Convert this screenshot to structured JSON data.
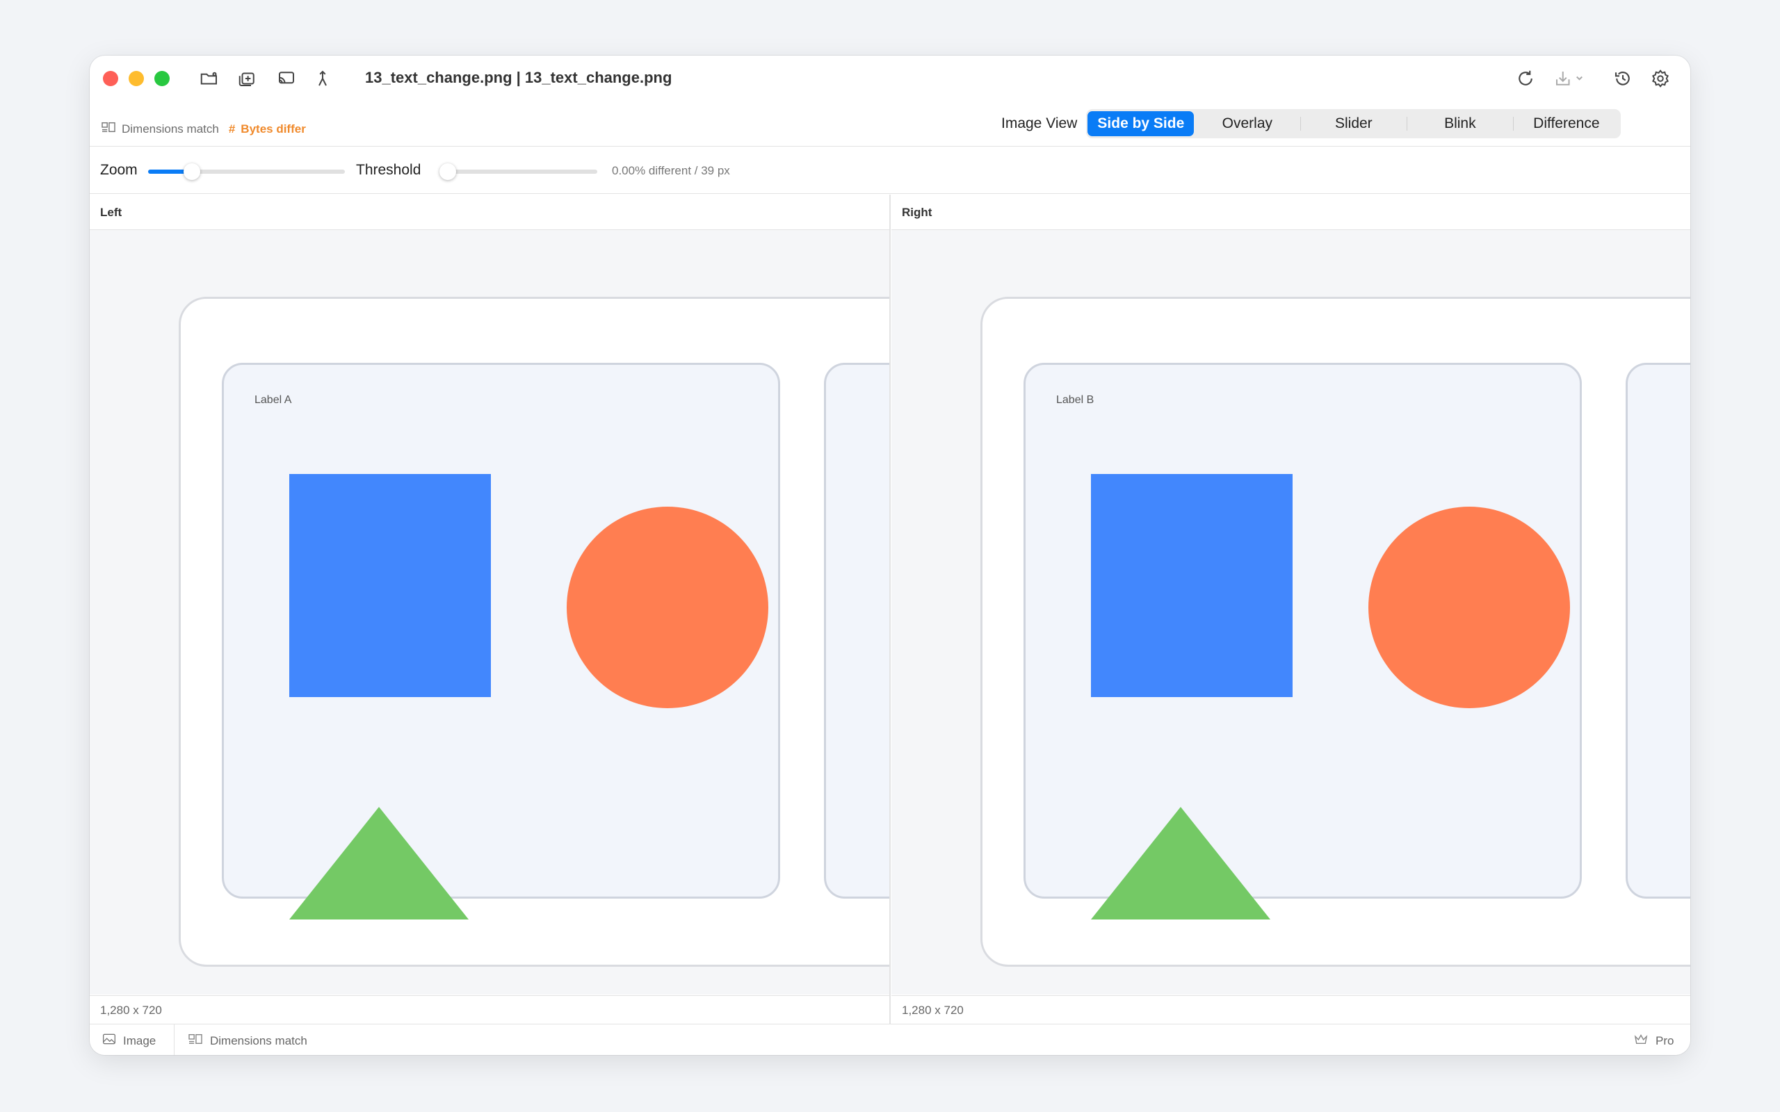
{
  "window": {
    "title": "13_text_change.png | 13_text_change.png"
  },
  "info": {
    "dimensions_match": "Dimensions match",
    "hash_symbol": "#",
    "bytes_differ": "Bytes differ"
  },
  "view_mode": {
    "label": "Image View",
    "options": [
      "Side by Side",
      "Overlay",
      "Slider",
      "Blink",
      "Difference"
    ],
    "selected": "Side by Side"
  },
  "controls": {
    "zoom_label": "Zoom",
    "zoom_level": 0.2,
    "threshold_label": "Threshold",
    "threshold_level": 0.0,
    "diff_text": "0.00% different / 39 px"
  },
  "panes": {
    "left": {
      "title": "Left",
      "image_label": "Label A",
      "dimensions": "1,280 x 720"
    },
    "right": {
      "title": "Right",
      "image_label": "Label B",
      "dimensions": "1,280 x 720"
    }
  },
  "statusbar": {
    "mode": "Image",
    "dimensions": "Dimensions match",
    "plan": "Pro"
  },
  "colors": {
    "accent": "#0a7cf6",
    "bytes_differ": "#f08a2c",
    "square": "#4287fd",
    "circle": "#ff7e51",
    "triangle": "#74c965"
  },
  "icons": [
    "open-folder-icon",
    "add-image-icon",
    "screen-icon",
    "merge-icon",
    "refresh-icon",
    "download-icon",
    "history-icon",
    "settings-icon",
    "dimensions-icon",
    "image-icon",
    "crown-icon"
  ]
}
